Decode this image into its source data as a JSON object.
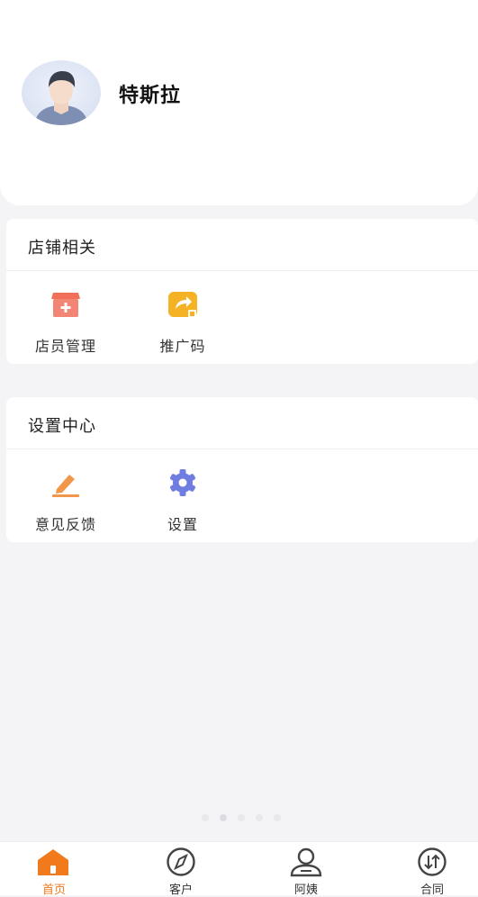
{
  "profile": {
    "name": "特斯拉"
  },
  "sections": [
    {
      "title": "店铺相关",
      "items": [
        {
          "label": "店员管理",
          "icon": "shop-staff-icon"
        },
        {
          "label": "推广码",
          "icon": "share-code-icon"
        }
      ]
    },
    {
      "title": "设置中心",
      "items": [
        {
          "label": "意见反馈",
          "icon": "edit-feedback-icon"
        },
        {
          "label": "设置",
          "icon": "gear-icon"
        }
      ]
    }
  ],
  "tabbar": {
    "items": [
      {
        "label": "首页",
        "icon": "home-icon",
        "active": true
      },
      {
        "label": "客户",
        "icon": "compass-icon",
        "active": false
      },
      {
        "label": "阿姨",
        "icon": "person-icon",
        "active": false
      },
      {
        "label": "合同",
        "icon": "swap-arrows-icon",
        "active": false
      }
    ]
  },
  "colors": {
    "accent": "#f07a1c",
    "icon_red": "#f0705a",
    "icon_yellow": "#f5b224",
    "icon_orange": "#f2964a",
    "icon_blue": "#6f7de0"
  }
}
